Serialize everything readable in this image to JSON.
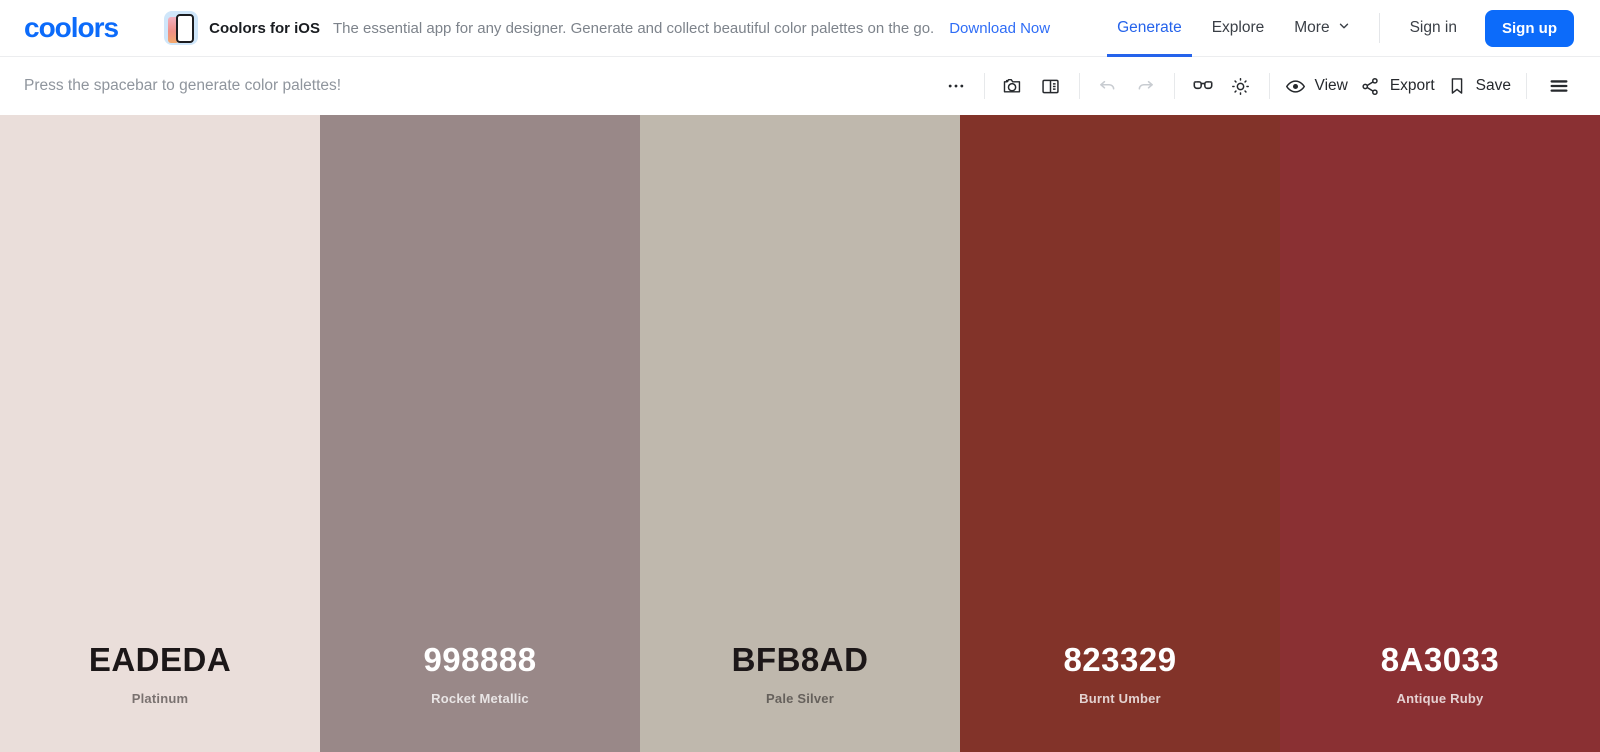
{
  "colors": {
    "brand_accent": "#0C6BFA",
    "active_link": "#2563EB"
  },
  "header": {
    "logo_text": "coolors",
    "banner": {
      "app_name": "Coolors for iOS",
      "tagline": "The essential app for any designer. Generate and collect beautiful color palettes on the go.",
      "link_label": "Download Now"
    },
    "nav": {
      "generate": "Generate",
      "explore": "Explore",
      "more": "More",
      "sign_in": "Sign in",
      "sign_up": "Sign up"
    }
  },
  "toolbar": {
    "hint": "Press the spacebar to generate color palettes!",
    "view_label": "View",
    "export_label": "Export",
    "save_label": "Save"
  },
  "icons": {
    "ellipsis-icon": "•••",
    "camera-icon": "camera outline",
    "collage-icon": "rect with list pane",
    "undo-icon": "curved arrow left (disabled)",
    "redo-icon": "curved arrow right (disabled)",
    "glasses-icon": "eyeglasses (color blindness)",
    "sun-icon": "brightness sun",
    "eye-icon": "eye (view)",
    "share-icon": "share nodes (export)",
    "bookmark-icon": "bookmark (save)",
    "menu-icon": "hamburger ≡",
    "chevron-down-icon": "⌄"
  },
  "palette": {
    "columns": [
      {
        "hex": "EADEDA",
        "name": "Platinum",
        "color": "#EADEDA",
        "theme": "dark"
      },
      {
        "hex": "998888",
        "name": "Rocket Metallic",
        "color": "#998888",
        "theme": "light"
      },
      {
        "hex": "BFB8AD",
        "name": "Pale Silver",
        "color": "#BFB8AD",
        "theme": "dark"
      },
      {
        "hex": "823329",
        "name": "Burnt Umber",
        "color": "#823329",
        "theme": "light"
      },
      {
        "hex": "8A3033",
        "name": "Antique Ruby",
        "color": "#8A3033",
        "theme": "light"
      }
    ]
  }
}
